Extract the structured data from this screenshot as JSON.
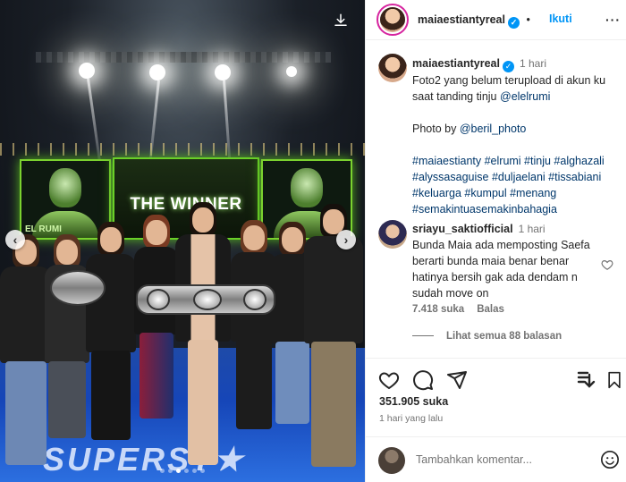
{
  "post": {
    "photo_alt": "",
    "screen_text": "THE WINNER",
    "screen_caption": "EL RUMI",
    "floor_text": "SUPERST★",
    "nav_prev": "‹",
    "nav_next": "›",
    "download_icon": "download-icon",
    "carousel_count": 6,
    "carousel_active": 2
  },
  "header": {
    "username": "maiaestiantyreal",
    "verified_mark": "✓",
    "separator": "•",
    "follow_label": "Ikuti",
    "more_label": "···"
  },
  "caption": {
    "username": "maiaestiantyreal",
    "time": "1 hari",
    "line1": "Foto2 yang belum terupload di akun ku saat tanding tinju ",
    "mention1": "@elelrumi",
    "photo_by": "Photo by ",
    "mention2": "@beril_photo",
    "hashtags": "#maiaestianty #elrumi #tinju #alghazali #alyssasaguise #duljaelani #tissabiani #keluarga #kumpul #menang #semakintuasemakinbahagia"
  },
  "comment": {
    "username": "sriayu_saktiofficial",
    "time": "1 hari",
    "text": "Bunda Maia ada memposting Saefa berarti bunda maia benar benar hatinya bersih gak ada dendam n sudah move on",
    "likes": "7.418 suka",
    "reply_label": "Balas",
    "view_replies": "Lihat semua 88 balasan"
  },
  "actions": {
    "likes": "351.905 suka",
    "date": "1 hari yang lalu"
  },
  "composer": {
    "placeholder": "Tambahkan komentar..."
  },
  "colors": {
    "accent": "#0095f6",
    "link": "#00376b",
    "muted": "#737373",
    "screen_green": "#6ad028",
    "floor_blue": "#1646b8"
  }
}
